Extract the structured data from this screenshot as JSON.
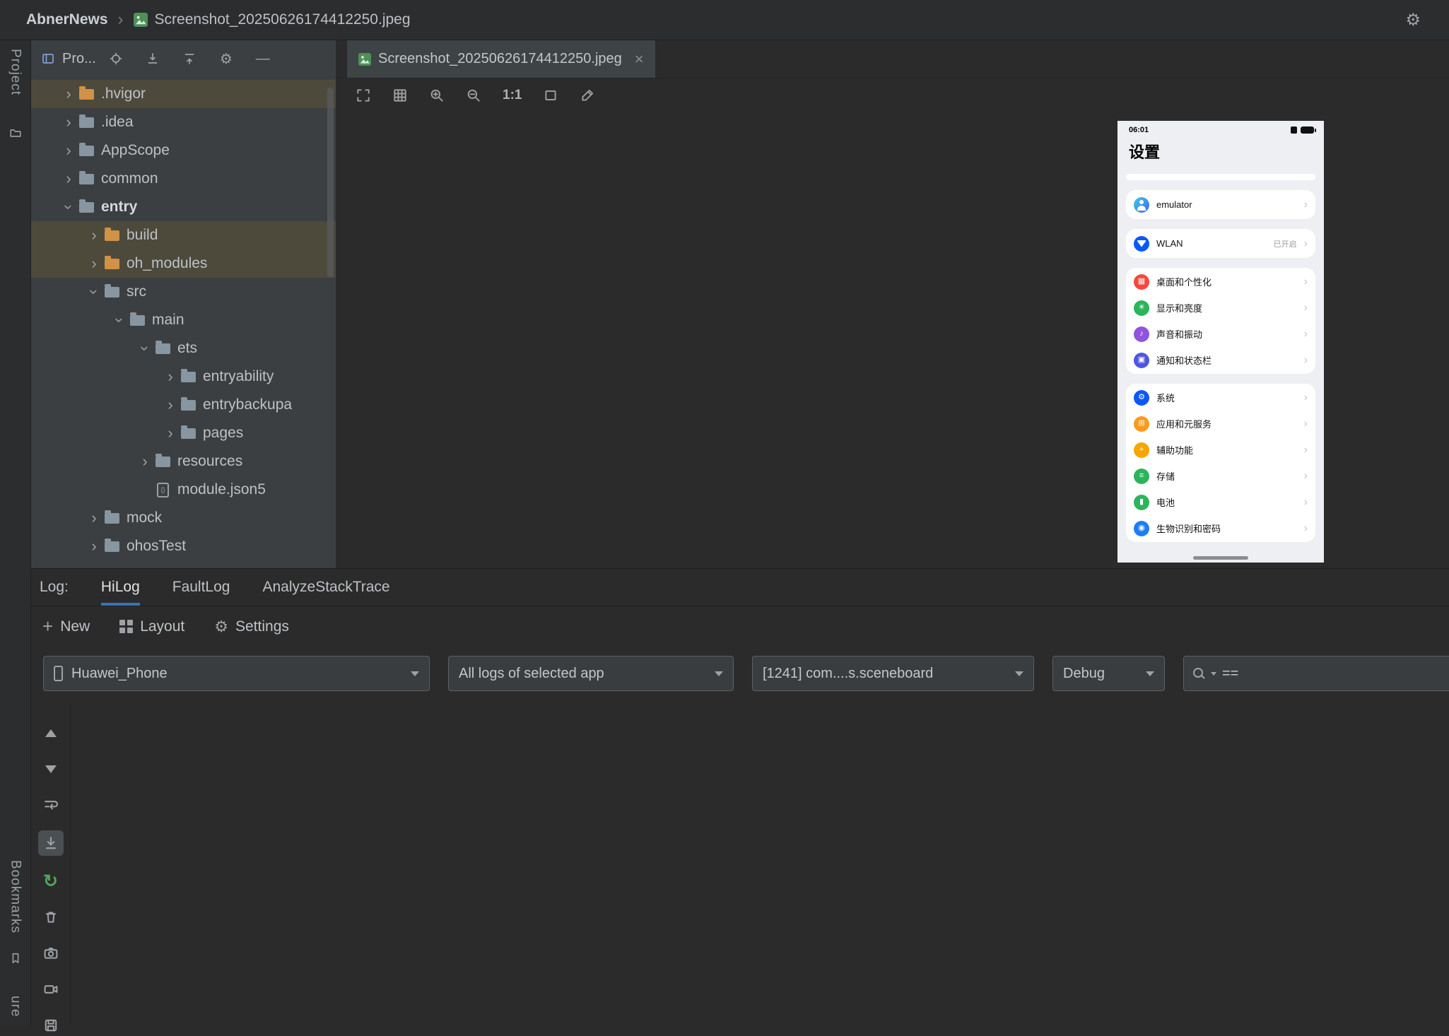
{
  "titlebar": {
    "project": "AbnerNews",
    "separator": "›",
    "file": "Screenshot_20250626174412250.jpeg"
  },
  "left_strip": {
    "project_label": "Project",
    "bookmarks_label": "Bookmarks",
    "partial_label": "ure"
  },
  "project_panel": {
    "title": "Pro...",
    "tree": [
      {
        "name": ".hvigor",
        "level": 1,
        "state": "collapsed",
        "folder": "orange",
        "highlighted": true
      },
      {
        "name": ".idea",
        "level": 1,
        "state": "collapsed",
        "folder": "normal"
      },
      {
        "name": "AppScope",
        "level": 1,
        "state": "collapsed",
        "folder": "normal"
      },
      {
        "name": "common",
        "level": 1,
        "state": "collapsed",
        "folder": "normal"
      },
      {
        "name": "entry",
        "level": 1,
        "state": "expanded",
        "folder": "normal",
        "bold": true
      },
      {
        "name": "build",
        "level": 2,
        "state": "collapsed",
        "folder": "orange",
        "highlighted": true
      },
      {
        "name": "oh_modules",
        "level": 2,
        "state": "collapsed",
        "folder": "orange",
        "highlighted": true
      },
      {
        "name": "src",
        "level": 2,
        "state": "expanded",
        "folder": "normal"
      },
      {
        "name": "main",
        "level": 3,
        "state": "expanded",
        "folder": "normal"
      },
      {
        "name": "ets",
        "level": 4,
        "state": "expanded",
        "folder": "normal"
      },
      {
        "name": "entryability",
        "level": 5,
        "state": "collapsed",
        "folder": "normal"
      },
      {
        "name": "entrybackupa",
        "level": 5,
        "state": "collapsed",
        "folder": "normal"
      },
      {
        "name": "pages",
        "level": 5,
        "state": "collapsed",
        "folder": "normal"
      },
      {
        "name": "resources",
        "level": 4,
        "state": "collapsed",
        "folder": "normal"
      },
      {
        "name": "module.json5",
        "level": 4,
        "state": "file",
        "folder": "file"
      },
      {
        "name": "mock",
        "level": 2,
        "state": "collapsed",
        "folder": "normal"
      },
      {
        "name": "ohosTest",
        "level": 2,
        "state": "collapsed",
        "folder": "normal"
      }
    ]
  },
  "editor": {
    "tab_title": "Screenshot_20250626174412250.jpeg",
    "close_glyph": "×",
    "zoom_label": "1:1"
  },
  "phone": {
    "status": {
      "time": "06:01"
    },
    "title": "设置",
    "emulator": {
      "label": "emulator",
      "icon": "avatar-icon"
    },
    "wlan": {
      "label": "WLAN",
      "value": "已开启",
      "icon": "wifi-icon",
      "color": "#0a59f7"
    },
    "group1": [
      {
        "label": "桌面和个性化",
        "icon": "desktop-icon",
        "color": "#f5493d"
      },
      {
        "label": "显示和亮度",
        "icon": "display-icon",
        "color": "#2db45a"
      },
      {
        "label": "声音和振动",
        "icon": "sound-icon",
        "color": "#9254de"
      },
      {
        "label": "通知和状态栏",
        "icon": "notification-icon",
        "color": "#4e56e2"
      }
    ],
    "group2": [
      {
        "label": "系统",
        "icon": "system-icon",
        "color": "#0a59f7"
      },
      {
        "label": "应用和元服务",
        "icon": "apps-icon",
        "color": "#f99b1d"
      },
      {
        "label": "辅助功能",
        "icon": "accessibility-icon",
        "color": "#f7a600"
      },
      {
        "label": "存储",
        "icon": "storage-icon",
        "color": "#2db45a"
      },
      {
        "label": "电池",
        "icon": "battery-glyph-icon",
        "color": "#2db45a"
      },
      {
        "label": "生物识别和密码",
        "icon": "biometric-icon",
        "color": "#1d7df8"
      }
    ]
  },
  "log": {
    "label": "Log:",
    "tabs": [
      {
        "label": "HiLog",
        "active": true
      },
      {
        "label": "FaultLog",
        "active": false
      },
      {
        "label": "AnalyzeStackTrace",
        "active": false
      }
    ],
    "actions": [
      {
        "label": "New"
      },
      {
        "label": "Layout"
      },
      {
        "label": "Settings"
      }
    ],
    "filters": {
      "device": "Huawei_Phone",
      "scope": "All logs of selected app",
      "process": "[1241] com....s.sceneboard",
      "level": "Debug",
      "search_value": "=="
    }
  }
}
